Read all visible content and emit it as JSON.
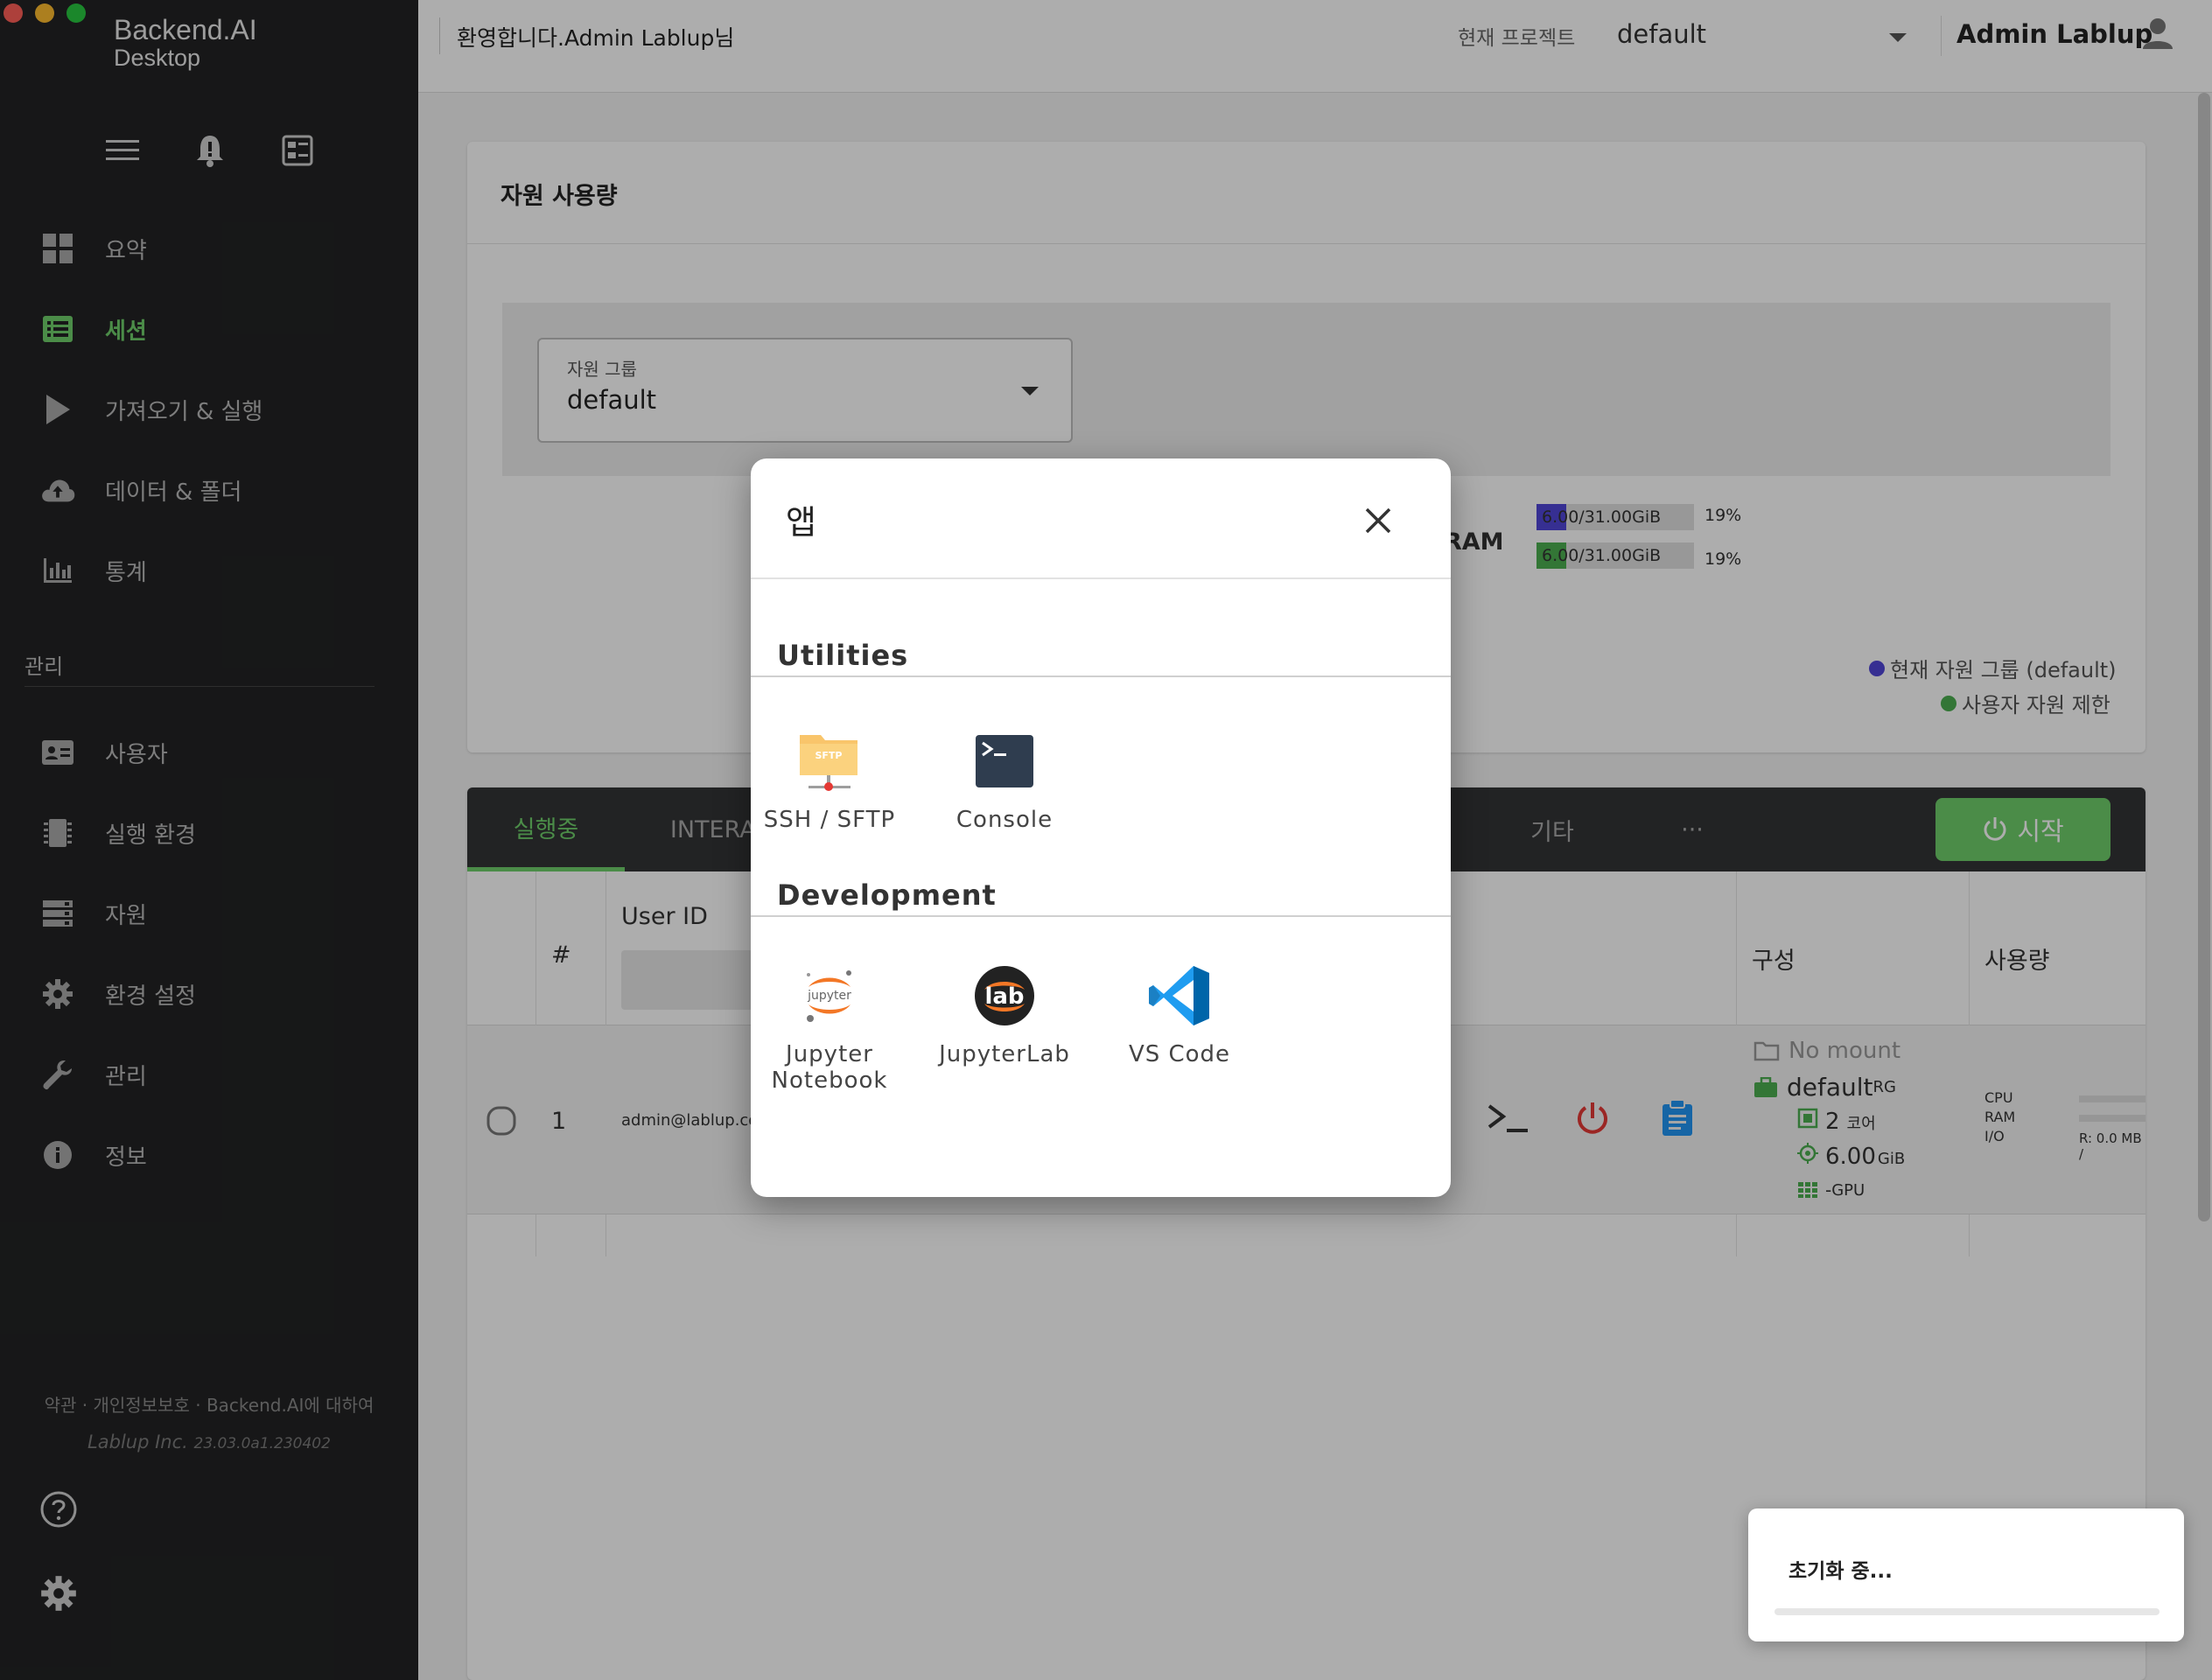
{
  "app": {
    "brand_line1": "Backend.AI",
    "brand_line2": "Desktop"
  },
  "colors": {
    "accent_green": "#6fcf6a",
    "sidebar_bg": "#222324",
    "legend_current_group": "#5046d8",
    "legend_user_limit": "#4caf50"
  },
  "sidebar": {
    "top_icons": [
      "menu-icon",
      "bell-icon",
      "dashboard-icon"
    ],
    "nav_items": [
      {
        "label": "요약",
        "icon": "grid-icon",
        "active": false
      },
      {
        "label": "세션",
        "icon": "list-icon",
        "active": true
      },
      {
        "label": "가져오기 & 실행",
        "icon": "play-icon",
        "active": false
      },
      {
        "label": "데이터 & 폴더",
        "icon": "cloud-upload-icon",
        "active": false
      },
      {
        "label": "통계",
        "icon": "bar-chart-icon",
        "active": false
      }
    ],
    "admin_section_label": "관리",
    "admin_items": [
      {
        "label": "사용자",
        "icon": "id-card-icon"
      },
      {
        "label": "실행 환경",
        "icon": "chip-icon"
      },
      {
        "label": "자원",
        "icon": "server-icon"
      },
      {
        "label": "환경 설정",
        "icon": "gear-icon"
      },
      {
        "label": "관리",
        "icon": "wrench-icon"
      },
      {
        "label": "정보",
        "icon": "info-icon"
      }
    ],
    "footer_links": "약관 · 개인정보보호 · Backend.AI에 대하여",
    "footer_company": "Lablup Inc.",
    "footer_version": "23.03.0a1.230402",
    "bottom_icons": [
      "help-icon",
      "settings-icon"
    ]
  },
  "header": {
    "welcome": "환영합니다.Admin Lablup님",
    "project_label": "현재 프로젝트",
    "project_value": "default",
    "user_name": "Admin Lablup"
  },
  "resource_card": {
    "title": "자원 사용량",
    "group_select_label": "자원 그룹",
    "group_select_value": "default",
    "ram_label": "RAM",
    "ram_bar1_text": "6.00/31.00GiB",
    "ram_bar1_percent": "19%",
    "ram_bar1_fraction": 0.19,
    "ram_bar2_text": "6.00/31.00GiB",
    "ram_bar2_percent": "19%",
    "ram_bar2_fraction": 0.19,
    "legend_current": "현재 자원 그룹 (default)",
    "legend_limit": "사용자 자원 제한"
  },
  "session_card": {
    "tabs": [
      "실행중",
      "INTERACTIVE",
      "기타",
      "···"
    ],
    "start_button": "시작",
    "columns": {
      "index": "#",
      "user_id": "User ID",
      "config": "구성",
      "usage": "사용량"
    },
    "row": {
      "index": "1",
      "user_id": "admin@lablup.com",
      "mount": "No mount",
      "resource_group": "default",
      "resource_group_suffix": "RG",
      "cpu_value": "2",
      "cpu_unit": "코어",
      "mem_value": "6.00",
      "mem_unit": "GiB",
      "gpu_value": "-",
      "gpu_unit": "GPU",
      "usage_labels": [
        "CPU",
        "RAM",
        "I/O"
      ],
      "io_text": "R: 0.0 MB /"
    }
  },
  "dialog": {
    "title": "앱",
    "categories": [
      {
        "name": "Utilities",
        "apps": [
          {
            "label": "SSH / SFTP",
            "icon": "sftp-folder-icon"
          },
          {
            "label": "Console",
            "icon": "console-icon"
          }
        ]
      },
      {
        "name": "Development",
        "apps": [
          {
            "label_line1": "Jupyter",
            "label_line2": "Notebook",
            "icon": "jupyter-icon"
          },
          {
            "label": "JupyterLab",
            "icon": "jupyterlab-icon"
          },
          {
            "label": "VS Code",
            "icon": "vscode-icon"
          }
        ]
      }
    ],
    "sftp_icon_text": "SFTP",
    "jupyter_icon_text": "jupyter",
    "jupyterlab_icon_text": "lab"
  },
  "toast": {
    "message": "초기화 중..."
  }
}
